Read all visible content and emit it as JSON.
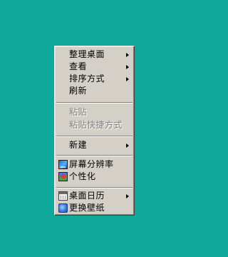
{
  "desktop": {
    "background_color": "#0fa89b"
  },
  "menu": {
    "items": [
      {
        "label": "整理桌面",
        "has_submenu": true,
        "enabled": true
      },
      {
        "label": "查看",
        "has_submenu": true,
        "enabled": true
      },
      {
        "label": "排序方式",
        "has_submenu": true,
        "enabled": true
      },
      {
        "label": "刷新",
        "has_submenu": false,
        "enabled": true
      },
      {
        "label": "粘贴",
        "has_submenu": false,
        "enabled": false
      },
      {
        "label": "粘贴快捷方式",
        "has_submenu": false,
        "enabled": false
      },
      {
        "label": "新建",
        "has_submenu": true,
        "enabled": true
      },
      {
        "label": "屏幕分辨率",
        "has_submenu": false,
        "enabled": true,
        "icon": "display-icon"
      },
      {
        "label": "个性化",
        "has_submenu": false,
        "enabled": true,
        "icon": "personalize-icon"
      },
      {
        "label": "桌面日历",
        "has_submenu": true,
        "enabled": true,
        "icon": "calendar-icon"
      },
      {
        "label": "更换壁纸",
        "has_submenu": false,
        "enabled": true,
        "icon": "wallpaper-icon"
      }
    ]
  }
}
